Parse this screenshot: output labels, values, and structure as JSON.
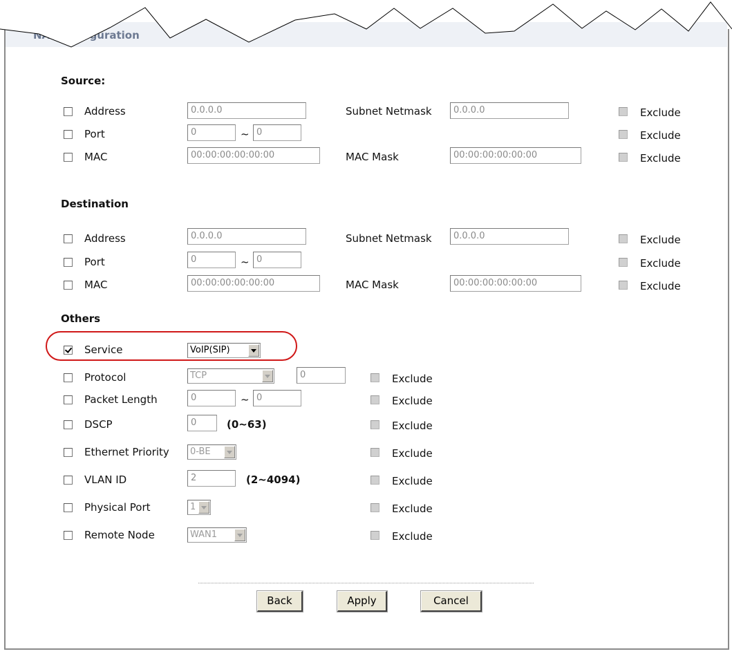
{
  "panel_title": "NAT Configuration",
  "source": {
    "title": "Source:",
    "address_label": "Address",
    "address_value": "0.0.0.0",
    "subnet_label": "Subnet Netmask",
    "subnet_value": "0.0.0.0",
    "port_label": "Port",
    "port_from": "0",
    "port_to": "0",
    "mac_label": "MAC",
    "mac_value": "00:00:00:00:00:00",
    "mac_mask_label": "MAC Mask",
    "mac_mask_value": "00:00:00:00:00:00"
  },
  "destination": {
    "title": "Destination",
    "address_label": "Address",
    "address_value": "0.0.0.0",
    "subnet_label": "Subnet Netmask",
    "subnet_value": "0.0.0.0",
    "port_label": "Port",
    "port_from": "0",
    "port_to": "0",
    "mac_label": "MAC",
    "mac_value": "00:00:00:00:00:00",
    "mac_mask_label": "MAC Mask",
    "mac_mask_value": "00:00:00:00:00:00"
  },
  "others": {
    "title": "Others",
    "service_label": "Service",
    "service_value": "VoIP(SIP)",
    "protocol_label": "Protocol",
    "protocol_value": "TCP",
    "protocol_number": "0",
    "packet_length_label": "Packet Length",
    "packet_from": "0",
    "packet_to": "0",
    "dscp_label": "DSCP",
    "dscp_value": "0",
    "dscp_range": "(0~63)",
    "ethernet_priority_label": "Ethernet Priority",
    "ethernet_priority_value": "0-BE",
    "vlan_label": "VLAN ID",
    "vlan_value": "2",
    "vlan_range": "(2~4094)",
    "physical_port_label": "Physical Port",
    "physical_port_value": "1",
    "remote_node_label": "Remote Node",
    "remote_node_value": "WAN1"
  },
  "exclude_label": "Exclude",
  "tilde": "~",
  "buttons": {
    "back": "Back",
    "apply": "Apply",
    "cancel": "Cancel"
  },
  "colors": {
    "highlight": "#d01818",
    "title_bar": "#eef1f6",
    "section_title_text": "#6d7a92"
  }
}
